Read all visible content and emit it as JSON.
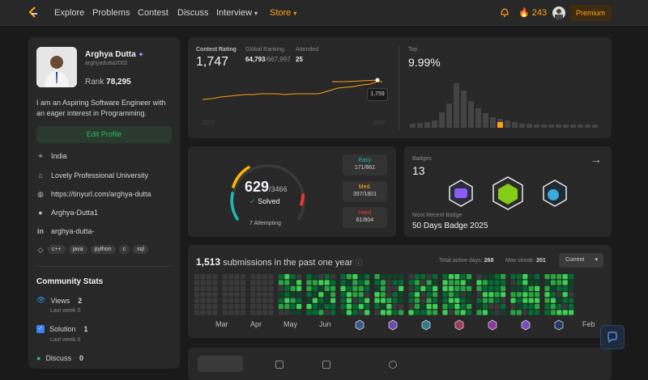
{
  "nav": {
    "items": [
      "Explore",
      "Problems",
      "Contest",
      "Discuss",
      "Interview",
      "Store"
    ],
    "streak_count": "243",
    "premium_label": "Premium"
  },
  "profile": {
    "name": "Arghya Dutta",
    "handle": "arghyadutta2002",
    "rank_label": "Rank",
    "rank_value": "78,295",
    "bio": "I am an Aspiring Software Engineer with an eager interest in Programming.",
    "edit_label": "Edit Profile",
    "location": "India",
    "school": "Lovely Professional University",
    "website": "https://tinyurl.com/arghya-dutta",
    "github": "Arghya-Dutta1",
    "linkedin": "arghya-dutta-",
    "skills": [
      "c++",
      "java",
      "python",
      "c",
      "sql"
    ]
  },
  "community": {
    "title": "Community Stats",
    "views_label": "Views",
    "views_value": "2",
    "views_week": "Last week 0",
    "solution_label": "Solution",
    "solution_value": "1",
    "solution_week": "Last week 0",
    "discuss_label": "Discuss",
    "discuss_value": "0"
  },
  "contest": {
    "rating_label": "Contest Rating",
    "rating_value": "1,747",
    "global_label": "Global Ranking",
    "global_value": "64,793",
    "global_total": "/667,997",
    "attended_label": "Attended",
    "attended_value": "25",
    "tooltip": "1,759",
    "top_label": "Top",
    "top_value": "9.99%",
    "x_start": "2023",
    "x_end": "2025"
  },
  "problems": {
    "solved": "629",
    "total": "/3466",
    "solved_label": "Solved",
    "attempting": "7 Attempting",
    "easy_label": "Easy",
    "easy_value": "171/861",
    "med_label": "Med.",
    "med_value": "397/1801",
    "hard_label": "Hard",
    "hard_value": "61/804"
  },
  "badges": {
    "label": "Badges",
    "count": "13",
    "recent_label": "Most Recent Badge",
    "recent_value": "50 Days Badge 2025"
  },
  "submissions": {
    "count": "1,513",
    "text": "submissions in the past one year",
    "active_label": "Total active days:",
    "active_value": "268",
    "streak_label": "Max streak:",
    "streak_value": "201",
    "select_label": "Current",
    "months": [
      "Mar",
      "Apr",
      "May",
      "Jun",
      "Feb"
    ]
  },
  "colors": {
    "accent": "#ffa116",
    "easy": "#1cbaba",
    "medium": "#ffb700",
    "hard": "#f63737",
    "green": "#2cbb5d"
  }
}
